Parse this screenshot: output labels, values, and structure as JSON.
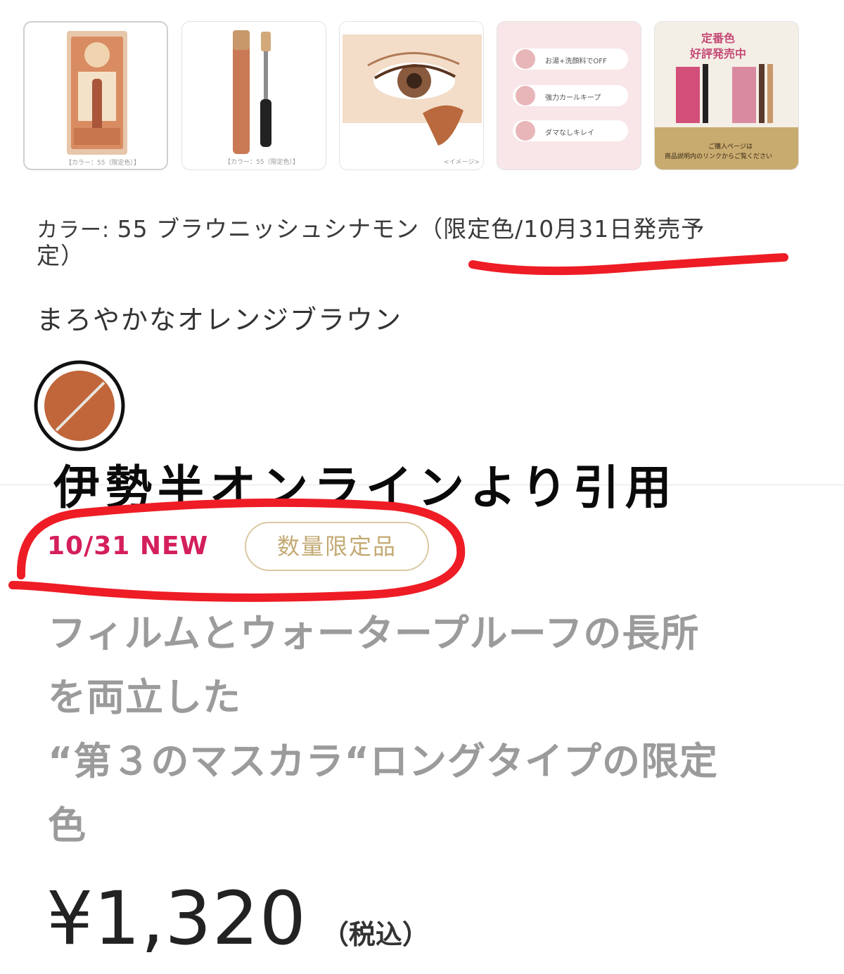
{
  "thumbnails": [
    {
      "label": "product-package",
      "caption": "【カラー：55（限定色）】"
    },
    {
      "label": "product-mascara",
      "caption": "【カラー：55（限定色）】"
    },
    {
      "label": "eye-image",
      "caption": "<イメージ>"
    },
    {
      "label": "features",
      "items": [
        "お湯+洗顔料でOFF",
        "強力カールキープ",
        "ダマなしキレイ"
      ]
    },
    {
      "label": "regular-colors",
      "heading1": "定番色",
      "heading2": "好評発売中",
      "footer1": "ご購入ページは",
      "footer2": "商品説明内のリンクからご覧ください"
    }
  ],
  "color": {
    "label": "カラー: ",
    "value_prefix": "55 ブラウニッシュシナモン（",
    "value_highlight": "限定色/10月31日発売予",
    "value_suffix": "定）"
  },
  "description": "まろやかなオレンジブラウン",
  "swatch_color": "#c0663a",
  "annotation": "伊勢半オンラインより引用",
  "badges": {
    "new": "10/31 NEW",
    "limited": "数量限定品"
  },
  "tagline": {
    "line1": "フィルムとウォータープルーフの長所",
    "line2": "を両立した",
    "line3": "“第３のマスカラ“ロングタイプの限定",
    "line4": "色"
  },
  "price": {
    "amount": "¥1,320",
    "tax": "（税込）"
  },
  "colors": {
    "new_badge": "#d41f5c",
    "limited_badge": "#c3aa74",
    "marker": "#ee1c25"
  }
}
